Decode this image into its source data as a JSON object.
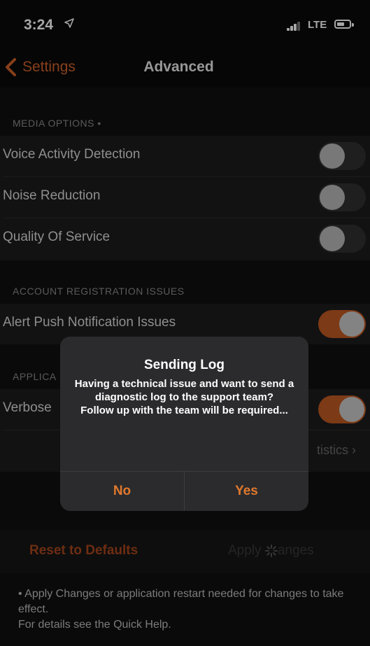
{
  "status_bar": {
    "time": "3:24",
    "network": "LTE"
  },
  "nav": {
    "back_label": "Settings",
    "title": "Advanced"
  },
  "media_options": {
    "header": "MEDIA OPTIONS •",
    "items": [
      {
        "label": "Voice Activity Detection",
        "on": false
      },
      {
        "label": "Noise Reduction",
        "on": false
      },
      {
        "label": "Quality Of Service",
        "on": false
      }
    ]
  },
  "account_registration": {
    "header": "ACCOUNT REGISTRATION ISSUES",
    "items": [
      {
        "label": "Alert Push Notification Issues",
        "on": true
      }
    ]
  },
  "application": {
    "header_partial": "APPLICA",
    "verbose_label_partial": "Verbose",
    "verbose_on": true,
    "stats_partial": "tistics"
  },
  "footer": {
    "reset_label": "Reset to Defaults",
    "apply_label_start": "Apply ",
    "apply_label_end": "anges",
    "note": "• Apply Changes or application restart needed for changes to take effect.\n For details see the Quick Help."
  },
  "dialog": {
    "title": "Sending Log",
    "message": "Having a technical issue and want to send a diagnostic log to the support team?\nFollow up with the team will be required...",
    "no_label": "No",
    "yes_label": "Yes"
  },
  "colors": {
    "accent": "#d2622a",
    "toggle_on": "#c15a23",
    "background": "#101010"
  }
}
